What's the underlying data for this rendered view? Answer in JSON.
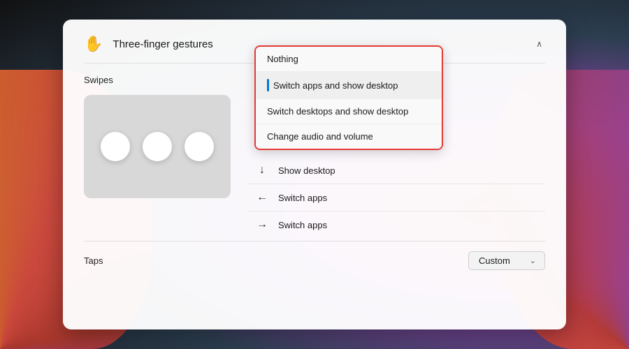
{
  "background": {
    "color_main": "#111111"
  },
  "panel": {
    "border_radius": "12px"
  },
  "section": {
    "title": "Three-finger gestures",
    "icon": "✋",
    "collapse_label": "∧"
  },
  "swipes": {
    "label": "Swipes"
  },
  "dropdown": {
    "items": [
      {
        "id": "nothing",
        "label": "Nothing",
        "selected": false
      },
      {
        "id": "switch-apps-show-desktop",
        "label": "Switch apps and show desktop",
        "selected": true
      },
      {
        "id": "switch-desktops-show-desktop",
        "label": "Switch desktops and show desktop",
        "selected": false
      },
      {
        "id": "change-audio-volume",
        "label": "Change audio and volume",
        "selected": false
      }
    ]
  },
  "actions": [
    {
      "arrow": "↓",
      "label": "Show desktop"
    },
    {
      "arrow": "←",
      "label": "Switch apps"
    },
    {
      "arrow": "→",
      "label": "Switch apps"
    }
  ],
  "taps": {
    "label": "Taps",
    "dropdown_value": "Custom",
    "chevron": "⌄"
  }
}
